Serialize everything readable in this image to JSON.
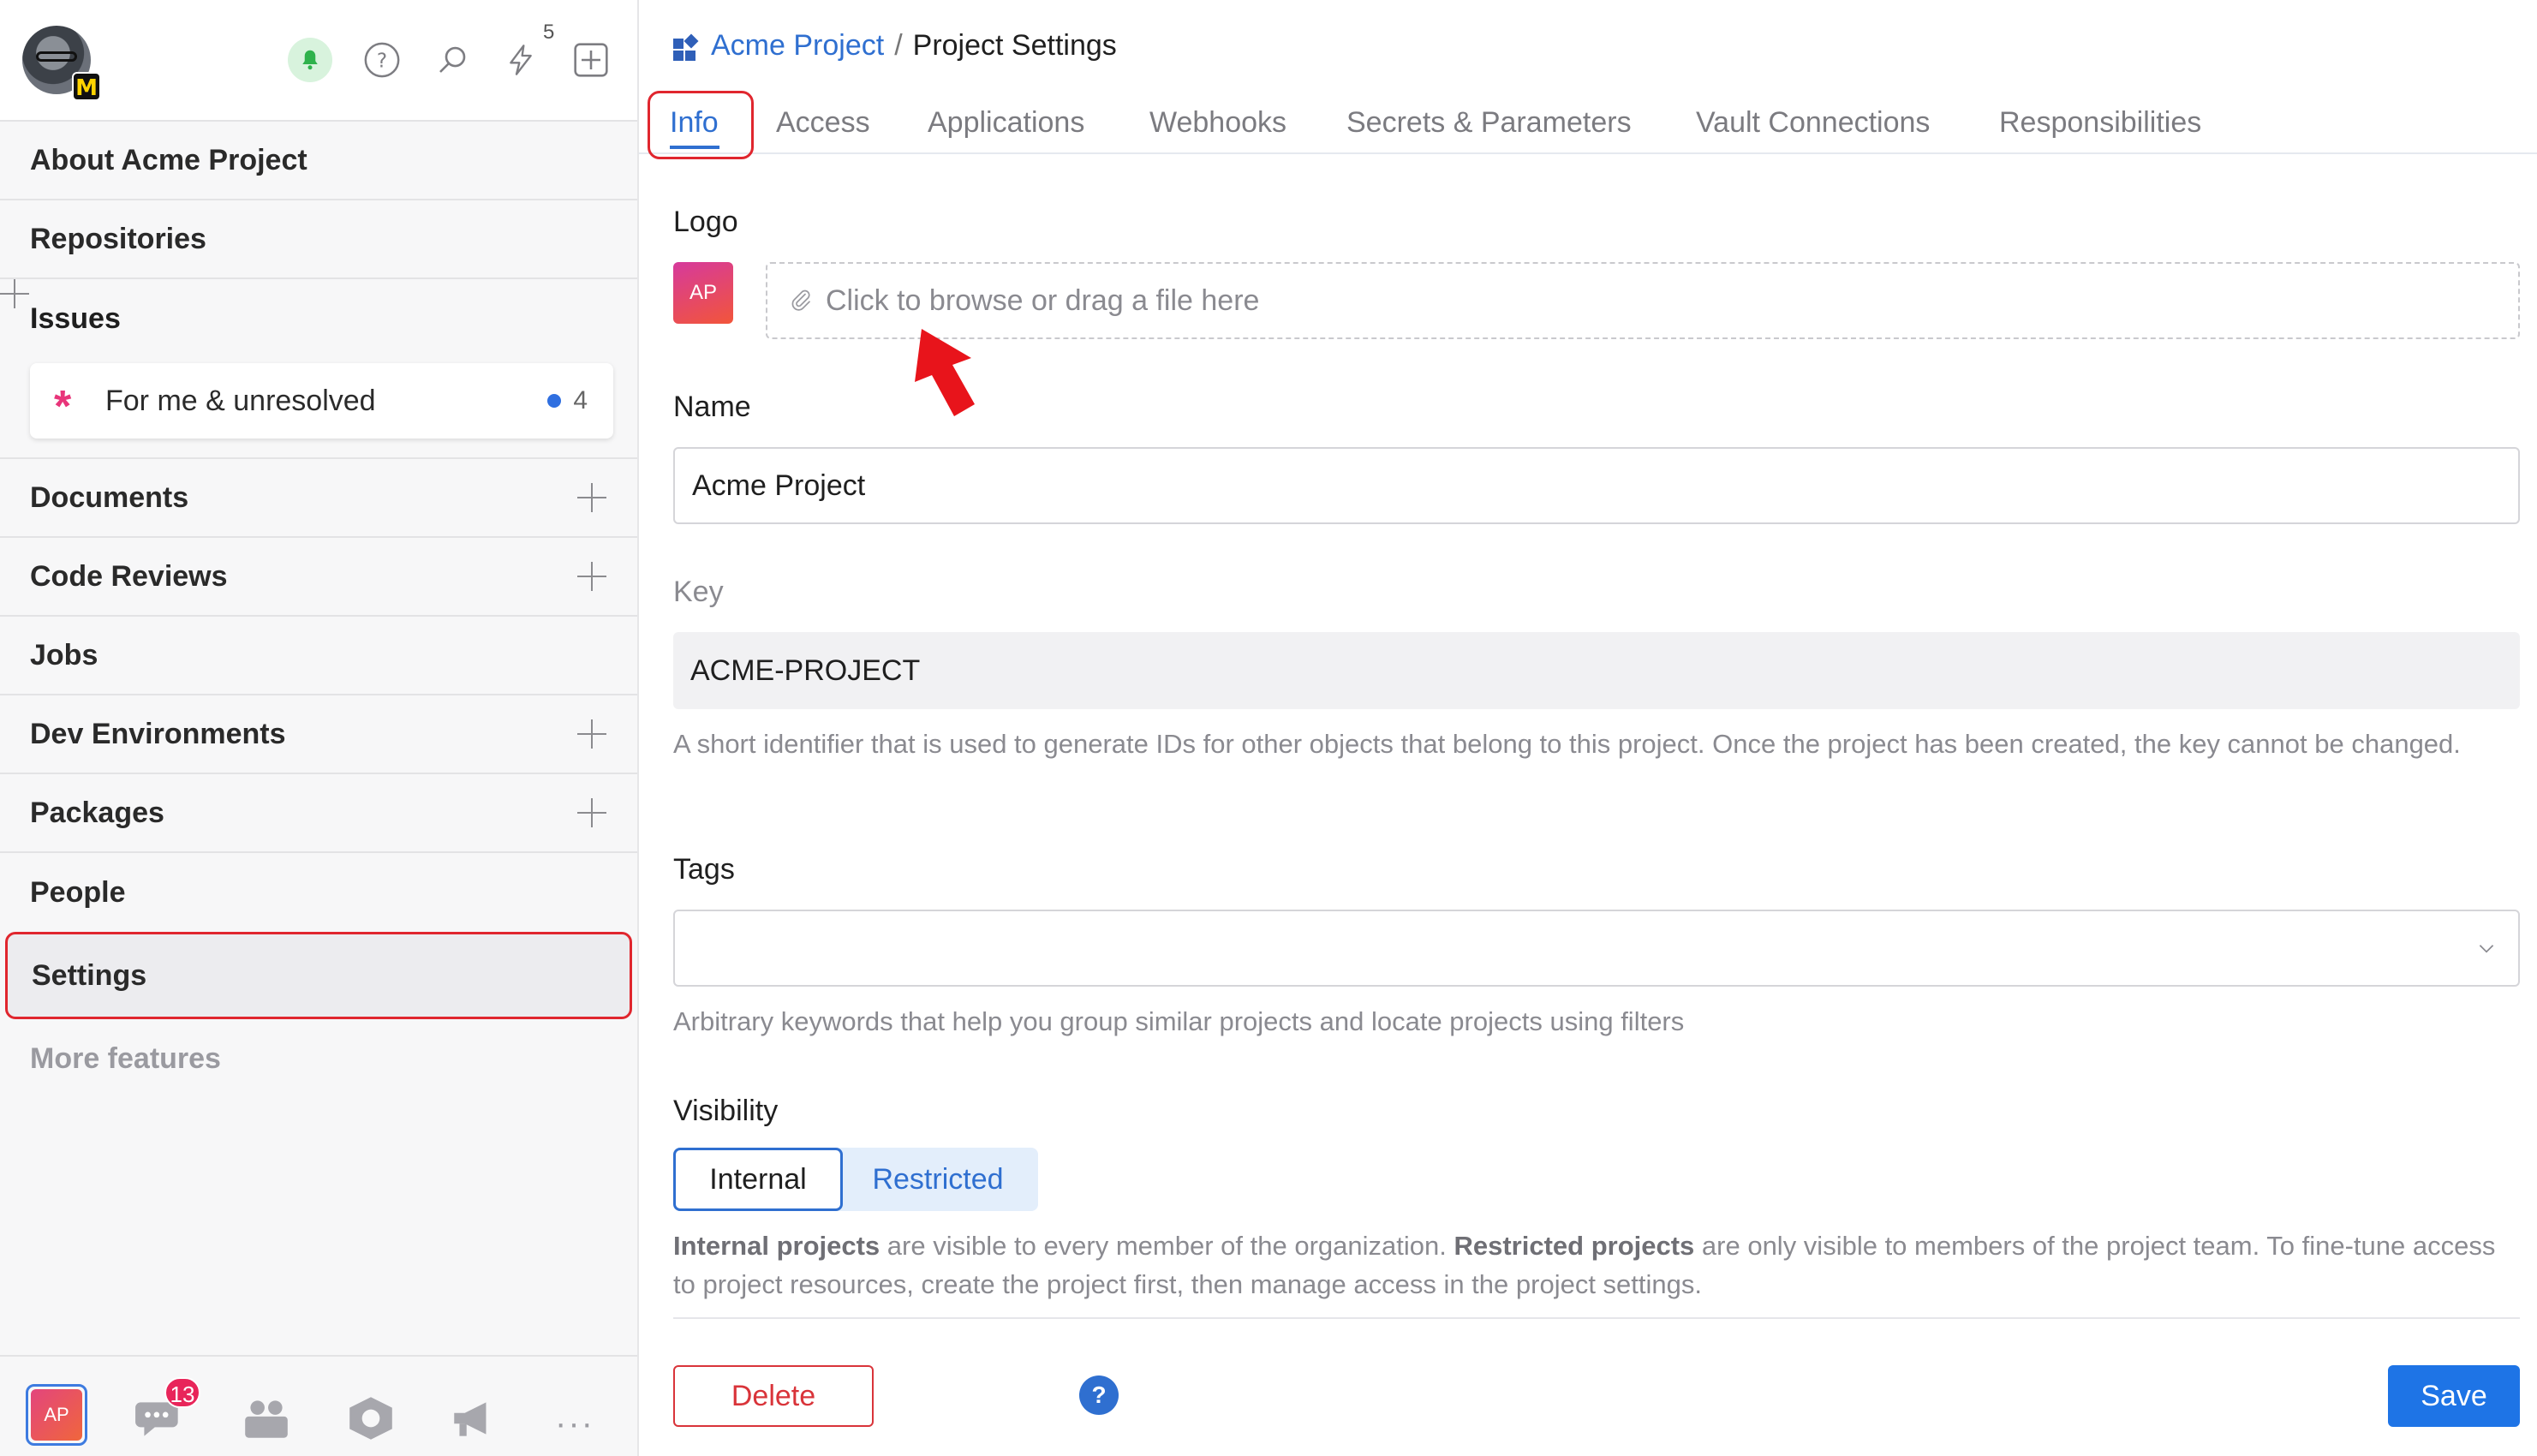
{
  "user": {
    "badge_letter": "M"
  },
  "toolbar": {
    "notifications_count": "5"
  },
  "sidebar": {
    "items": [
      {
        "label": "About Acme Project"
      },
      {
        "label": "Repositories"
      },
      {
        "label": "Issues"
      },
      {
        "label": "Documents"
      },
      {
        "label": "Code Reviews"
      },
      {
        "label": "Jobs"
      },
      {
        "label": "Dev Environments"
      },
      {
        "label": "Packages"
      },
      {
        "label": "People"
      },
      {
        "label": "Settings"
      },
      {
        "label": "More features"
      }
    ],
    "issue_filter": {
      "label": "For me & unresolved",
      "count": "4"
    }
  },
  "bottom_bar": {
    "project_initials": "AP",
    "chat_badge": "13"
  },
  "breadcrumb": {
    "project": "Acme Project",
    "separator": "/",
    "current": "Project Settings"
  },
  "tabs": [
    "Info",
    "Access",
    "Applications",
    "Webhooks",
    "Secrets & Parameters",
    "Vault Connections",
    "Responsibilities"
  ],
  "form": {
    "logo": {
      "label": "Logo",
      "initials": "AP",
      "dropzone": "Click to browse or drag a file here"
    },
    "name": {
      "label": "Name",
      "value": "Acme Project"
    },
    "key": {
      "label": "Key",
      "value": "ACME-PROJECT",
      "hint": "A short identifier that is used to generate IDs for other objects that belong to this project. Once the project has been created, the key cannot be changed."
    },
    "tags": {
      "label": "Tags",
      "value": "",
      "hint": "Arbitrary keywords that help you group similar projects and locate projects using filters"
    },
    "visibility": {
      "label": "Visibility",
      "options": [
        "Internal",
        "Restricted"
      ],
      "selected": "Internal",
      "hint_bold_1": "Internal projects",
      "hint_text_1": " are visible to every member of the organization. ",
      "hint_bold_2": "Restricted projects",
      "hint_text_2": " are only visible to members of the project team. To fine-tune access to project resources, create the project first, then manage access in the project settings."
    }
  },
  "actions": {
    "delete": "Delete",
    "help": "?",
    "save": "Save"
  },
  "colors": {
    "accent": "#2f6fd0",
    "danger": "#d9343a",
    "save": "#1e74e6",
    "highlight": "#e0262e"
  }
}
